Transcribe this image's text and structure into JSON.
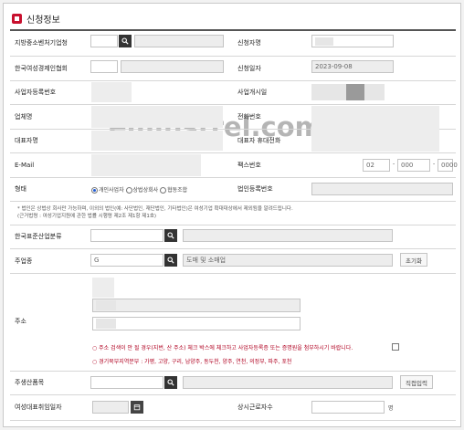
{
  "section": {
    "title": "신청정보"
  },
  "watermark": "eminstrel.com",
  "rows": {
    "r1": {
      "label_left": "지방중소벤처기업청",
      "label_right": "신청자명"
    },
    "r2": {
      "label_left": "한국여성경제인협회",
      "label_right": "신청일자",
      "date_value": "2023-09-08"
    },
    "r3": {
      "label_left": "사업자등록번호",
      "label_right": "사업개시일"
    },
    "r4": {
      "label_left": "업체명",
      "label_right": "전화번호"
    },
    "r5": {
      "label_left": "대표자명",
      "label_right": "대표자 휴대전화"
    },
    "r6": {
      "label_left": "E-Mail",
      "label_right": "팩스번호",
      "fax1": "02",
      "fax2": "000",
      "fax3": "0000",
      "dash": "-"
    },
    "r7": {
      "label_left": "형태",
      "label_right": "법인등록번호",
      "options": [
        "개인사업자",
        "상법상회사",
        "협동조합"
      ],
      "selected": "개인사업자"
    }
  },
  "notes": {
    "line1": "* 법인은 상법상 회사만 가능하며, 이외의 법인(예: 사단법인, 재단법인, 기타법인)은 여성기업 확대대상에서 제외됨을 알려드립니다.",
    "line2": "(근거법령 : 여성기업지원에 관한 법률 시행령 제2조 제1항 제1호)"
  },
  "industry": {
    "label": "한국표준산업분류"
  },
  "main_business": {
    "label": "주업종",
    "code": "G",
    "name": "도매 및 소매업",
    "reset_label": "초기화"
  },
  "address": {
    "label": "주소",
    "note1": "○ 주소 검색이 안 될 경우(지번, 산 주소) 체크 박스에 체크하고 사업자등록증 또는 증명원을 첨부하시기 바랍니다.",
    "note2": "○ 경기북부지역분부 : 가평, 고양, 구리, 남양주, 동두천, 양주, 연천, 의정부, 파주, 포천"
  },
  "product": {
    "label": "주생산품목",
    "direct_label": "직접입력"
  },
  "ceo_date": {
    "label": "여성대표취임일자"
  },
  "employees": {
    "label": "상시근로자수",
    "unit": "명"
  },
  "icons": {
    "search": "search-icon",
    "calendar": "calendar-icon",
    "section": "section-square-icon"
  },
  "colors": {
    "accent": "#c8102e",
    "button_dark": "#333333",
    "note_red": "#b00020"
  }
}
